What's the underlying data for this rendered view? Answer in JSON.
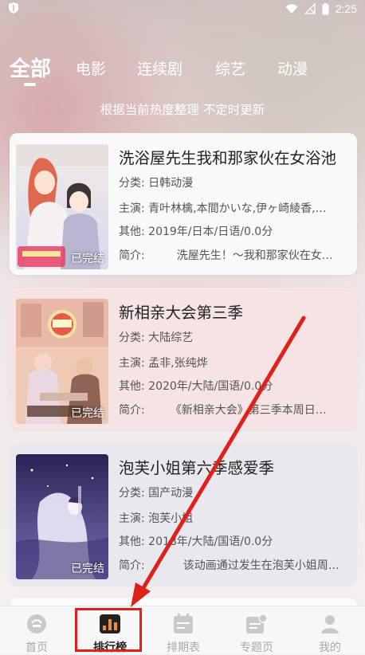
{
  "status_bar": {
    "time": "2:25"
  },
  "category_tabs": [
    {
      "label": "全部",
      "active": true
    },
    {
      "label": "电影"
    },
    {
      "label": "连续剧"
    },
    {
      "label": "综艺"
    },
    {
      "label": "动漫"
    }
  ],
  "subtitle": "根据当前热度整理 不定时更新",
  "list": [
    {
      "title": "洗浴屋先生我和那家伙在女浴池",
      "category_label": "分类:",
      "category": "日韩动漫",
      "cast_label": "主演:",
      "cast": "青叶林檎,本間かいな,伊ヶ崎綾香,…",
      "other_label": "其他:",
      "other": "2019年/日本/日语/0.0分",
      "intro_label": "简介:",
      "intro": "洗屋先生！～我和那家伙在女…",
      "status": "已完结"
    },
    {
      "title": "新相亲大会第三季",
      "category_label": "分类:",
      "category": "大陆综艺",
      "cast_label": "主演:",
      "cast": "孟非,张纯烨",
      "other_label": "其他:",
      "other": "2020年/大陆/国语/0.0分",
      "intro_label": "简介:",
      "intro": "《新相亲大会》第三季本周日…",
      "status": "已完结"
    },
    {
      "title": "泡芙小姐第六季感爱季",
      "category_label": "分类:",
      "category": "国产动漫",
      "cast_label": "主演:",
      "cast": "泡芙小姐",
      "other_label": "其他:",
      "other": "2018年/大陆/国语/0.0分",
      "intro_label": "简介:",
      "intro": "该动画通过发生在泡芙小姐周…",
      "status": "已完结"
    }
  ],
  "bottom_tabs": [
    {
      "label": "首页",
      "icon": "home-icon"
    },
    {
      "label": "排行榜",
      "icon": "ranking-icon",
      "active": true
    },
    {
      "label": "排期表",
      "icon": "calendar-icon"
    },
    {
      "label": "专题页",
      "icon": "topic-icon"
    },
    {
      "label": "我的",
      "icon": "profile-icon"
    }
  ],
  "colors": {
    "accent": "#e0201b",
    "active_text": "#222222",
    "inactive_text": "#aaaaaa"
  }
}
